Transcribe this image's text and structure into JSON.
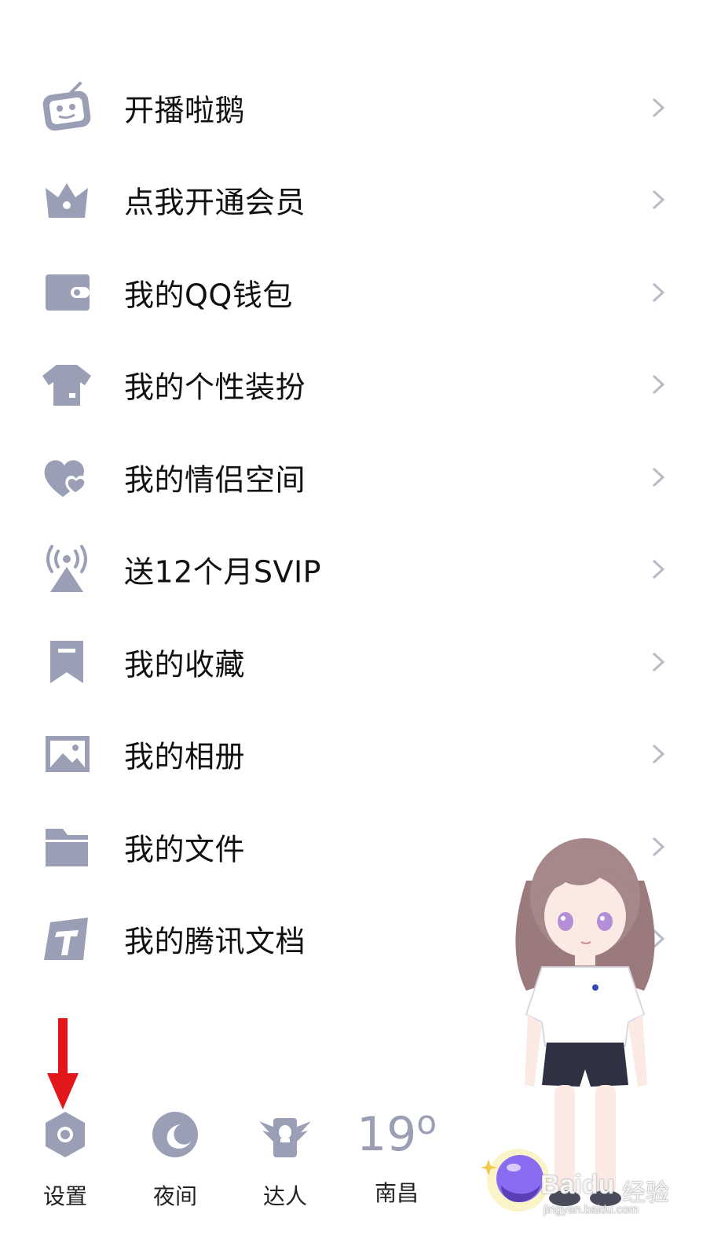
{
  "colors": {
    "icon_gray": "#9a9fb6",
    "text": "#111111",
    "chevron": "#b8bbc6",
    "arrow": "#e3161b",
    "orb": "#8a6cf0"
  },
  "menu": {
    "items": [
      {
        "label": "开播啦鹅",
        "icon": "tv-robot-icon"
      },
      {
        "label": "点我开通会员",
        "icon": "crown-icon"
      },
      {
        "label": "我的QQ钱包",
        "icon": "wallet-icon"
      },
      {
        "label": "我的个性装扮",
        "icon": "tshirt-icon"
      },
      {
        "label": "我的情侣空间",
        "icon": "hearts-icon"
      },
      {
        "label": "送12个月SVIP",
        "icon": "broadcast-icon"
      },
      {
        "label": "我的收藏",
        "icon": "bookmark-icon"
      },
      {
        "label": "我的相册",
        "icon": "photo-icon"
      },
      {
        "label": "我的文件",
        "icon": "folder-icon"
      },
      {
        "label": "我的腾讯文档",
        "icon": "tencent-docs-icon"
      }
    ]
  },
  "toolbar": {
    "settings_label": "设置",
    "night_label": "夜间",
    "expert_label": "达人",
    "weather_temp": "19",
    "weather_degree": "o",
    "weather_city": "南昌"
  },
  "watermark": {
    "brand": "Baidu",
    "cn": "经验",
    "url": "jingyan.baidu.com"
  }
}
